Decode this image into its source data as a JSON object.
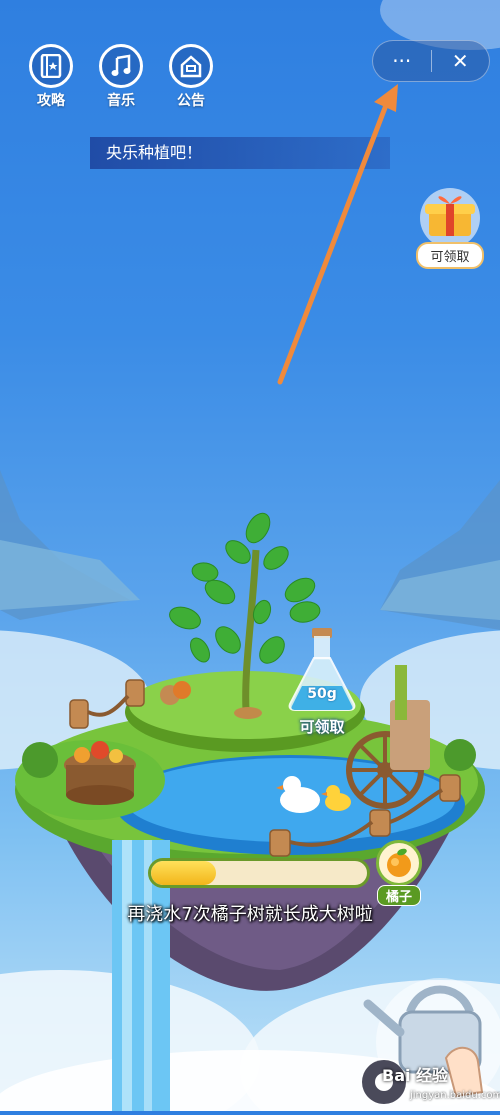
{
  "nav": {
    "guide_label": "攻略",
    "music_label": "音乐",
    "notice_label": "公告"
  },
  "capsule": {
    "more_glyph": "···",
    "close_glyph": "✕"
  },
  "banner": {
    "text": "央乐种植吧！"
  },
  "gift": {
    "label": "可领取"
  },
  "flask": {
    "amount": "50g",
    "label": "可领取"
  },
  "progress": {
    "percent": 0.3
  },
  "fruit": {
    "label": "橘子"
  },
  "hint": {
    "text": "再浇水7次橘子树就长成大树啦"
  },
  "watermark": {
    "brand": "Bai 经验",
    "sub": "jingyan.baidu.com"
  },
  "icons": {
    "guide": "book-icon",
    "music": "music-note-icon",
    "notice": "home-icon",
    "gift": "gift-box-icon",
    "flask": "flask-icon",
    "fruit": "orange-icon",
    "watering": "watering-can-icon"
  },
  "colors": {
    "sky": "#3b8ce6",
    "grass": "#6abf3a",
    "water": "#2f9ee8",
    "annotation_arrow": "#f08a3c"
  }
}
